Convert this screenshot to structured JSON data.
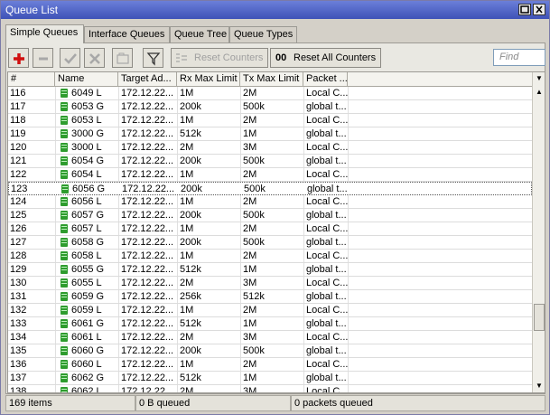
{
  "window": {
    "title": "Queue List"
  },
  "tabs": [
    {
      "label": "Simple Queues",
      "active": true
    },
    {
      "label": "Interface Queues",
      "active": false
    },
    {
      "label": "Queue Tree",
      "active": false
    },
    {
      "label": "Queue Types",
      "active": false
    }
  ],
  "toolbar": {
    "reset_counters_label": "Reset Counters",
    "reset_all_counters_label": "Reset All Counters",
    "reset_all_prefix": "00",
    "find_placeholder": "Find"
  },
  "columns": [
    "#",
    "Name",
    "Target Ad...",
    "Rx Max Limit",
    "Tx Max Limit",
    "Packet ..."
  ],
  "rows": [
    {
      "num": "116",
      "name": "6049 L",
      "target": "172.12.22...",
      "rx": "1M",
      "tx": "2M",
      "packet": "Local C..."
    },
    {
      "num": "117",
      "name": "6053 G",
      "target": "172.12.22...",
      "rx": "200k",
      "tx": "500k",
      "packet": "global t..."
    },
    {
      "num": "118",
      "name": "6053 L",
      "target": "172.12.22...",
      "rx": "1M",
      "tx": "2M",
      "packet": "Local C..."
    },
    {
      "num": "119",
      "name": "3000 G",
      "target": "172.12.22...",
      "rx": "512k",
      "tx": "1M",
      "packet": "global t..."
    },
    {
      "num": "120",
      "name": "3000 L",
      "target": "172.12.22...",
      "rx": "2M",
      "tx": "3M",
      "packet": "Local C..."
    },
    {
      "num": "121",
      "name": "6054 G",
      "target": "172.12.22...",
      "rx": "200k",
      "tx": "500k",
      "packet": "global t..."
    },
    {
      "num": "122",
      "name": "6054 L",
      "target": "172.12.22...",
      "rx": "1M",
      "tx": "2M",
      "packet": "Local C..."
    },
    {
      "num": "123",
      "name": "6056 G",
      "target": "172.12.22...",
      "rx": "200k",
      "tx": "500k",
      "packet": "global t...",
      "selected": true
    },
    {
      "num": "124",
      "name": "6056 L",
      "target": "172.12.22...",
      "rx": "1M",
      "tx": "2M",
      "packet": "Local C..."
    },
    {
      "num": "125",
      "name": "6057 G",
      "target": "172.12.22...",
      "rx": "200k",
      "tx": "500k",
      "packet": "global t..."
    },
    {
      "num": "126",
      "name": "6057 L",
      "target": "172.12.22...",
      "rx": "1M",
      "tx": "2M",
      "packet": "Local C..."
    },
    {
      "num": "127",
      "name": "6058 G",
      "target": "172.12.22...",
      "rx": "200k",
      "tx": "500k",
      "packet": "global t..."
    },
    {
      "num": "128",
      "name": "6058 L",
      "target": "172.12.22...",
      "rx": "1M",
      "tx": "2M",
      "packet": "Local C..."
    },
    {
      "num": "129",
      "name": "6055 G",
      "target": "172.12.22...",
      "rx": "512k",
      "tx": "1M",
      "packet": "global t..."
    },
    {
      "num": "130",
      "name": "6055 L",
      "target": "172.12.22...",
      "rx": "2M",
      "tx": "3M",
      "packet": "Local C..."
    },
    {
      "num": "131",
      "name": "6059 G",
      "target": "172.12.22...",
      "rx": "256k",
      "tx": "512k",
      "packet": "global t..."
    },
    {
      "num": "132",
      "name": "6059 L",
      "target": "172.12.22...",
      "rx": "1M",
      "tx": "2M",
      "packet": "Local C..."
    },
    {
      "num": "133",
      "name": "6061 G",
      "target": "172.12.22...",
      "rx": "512k",
      "tx": "1M",
      "packet": "global t..."
    },
    {
      "num": "134",
      "name": "6061 L",
      "target": "172.12.22...",
      "rx": "2M",
      "tx": "3M",
      "packet": "Local C..."
    },
    {
      "num": "135",
      "name": "6060 G",
      "target": "172.12.22...",
      "rx": "200k",
      "tx": "500k",
      "packet": "global t..."
    },
    {
      "num": "136",
      "name": "6060 L",
      "target": "172.12.22...",
      "rx": "1M",
      "tx": "2M",
      "packet": "Local C..."
    },
    {
      "num": "137",
      "name": "6062 G",
      "target": "172.12.22...",
      "rx": "512k",
      "tx": "1M",
      "packet": "global t..."
    },
    {
      "num": "138",
      "name": "6062 L",
      "target": "172.12.22...",
      "rx": "2M",
      "tx": "3M",
      "packet": "Local C..."
    }
  ],
  "status": {
    "items": "169 items",
    "queued": "0 B queued",
    "packets": "0 packets queued"
  },
  "colors": {
    "title_bar": "#4a5ec0",
    "queue_icon": "#2e9c2e",
    "add_icon": "#d01010"
  },
  "icons": [
    "plus-icon",
    "minus-icon",
    "check-icon",
    "cross-icon",
    "comment-icon",
    "filter-icon",
    "reset-counters-icon",
    "scroll-up-icon",
    "scroll-down-icon",
    "queue-icon"
  ]
}
